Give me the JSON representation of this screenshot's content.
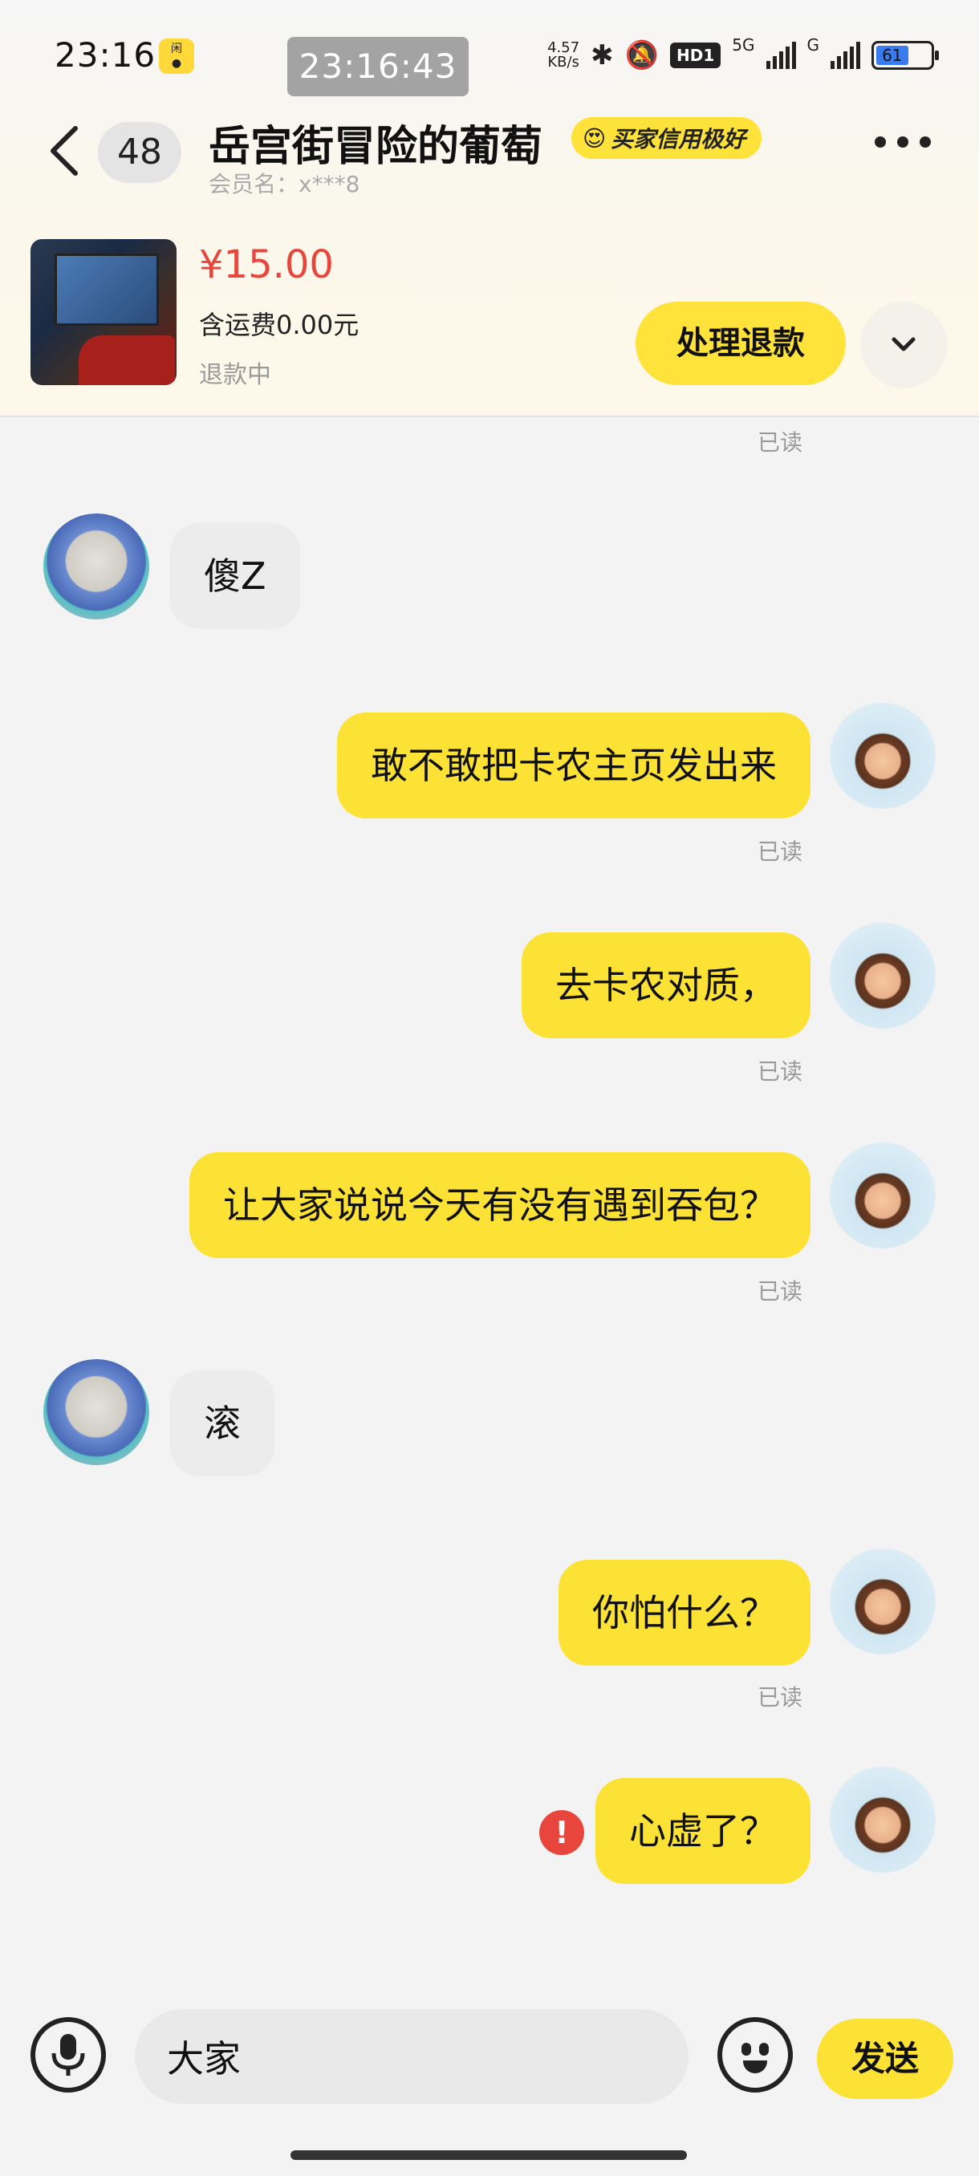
{
  "status_bar": {
    "time": "23:16",
    "clock_overlay": "23:16:43",
    "network_speed_value": "4.57",
    "network_speed_unit": "KB/s",
    "hd_badge": "HD1",
    "signal_1_label": "5G",
    "signal_2_label": "G",
    "battery_level": "61"
  },
  "header": {
    "unread_count": "48",
    "peer_name": "岳宫街冒险的葡萄",
    "credit_badge": "买家信用极好",
    "member_label": "会员名：x***8"
  },
  "order": {
    "price": "¥15.00",
    "shipping": "含运费0.00元",
    "status": "退款中",
    "refund_button": "处理退款"
  },
  "chat": {
    "read_label": "已读",
    "messages": [
      {
        "from": "peer",
        "text": "傻Z"
      },
      {
        "from": "self",
        "text": "敢不敢把卡农主页发出来",
        "read": true
      },
      {
        "from": "self",
        "text": "去卡农对质，",
        "read": true
      },
      {
        "from": "self",
        "text": "让大家说说今天有没有遇到吞包？",
        "read": true
      },
      {
        "from": "peer",
        "text": "滚"
      },
      {
        "from": "self",
        "text": "你怕什么？",
        "read": true
      },
      {
        "from": "self",
        "text": "心虚了？",
        "read": false,
        "failed": true
      }
    ]
  },
  "input_bar": {
    "value": "大家",
    "send_label": "发送"
  },
  "colors": {
    "accent_yellow": "#fde236",
    "price_red": "#e8453c",
    "peer_bubble": "#ececec"
  },
  "icons": [
    "back-icon",
    "more-icon",
    "chevron-down-icon",
    "microphone-icon",
    "emoji-icon",
    "error-icon",
    "bluetooth-icon",
    "mute-icon"
  ]
}
